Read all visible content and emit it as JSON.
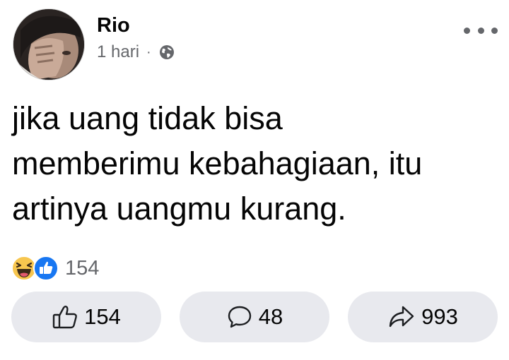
{
  "post": {
    "author": "Rio",
    "time": "1 hari",
    "separator": "·",
    "privacy_icon": "globe-icon",
    "text": "jika uang tidak bisa\nmemberimu kebahagiaan, itu\nartinya uangmu kurang."
  },
  "reactions": {
    "types": [
      "haha-icon",
      "like-icon"
    ],
    "count": "154"
  },
  "actions": {
    "like": {
      "icon": "thumbs-up-icon",
      "count": "154"
    },
    "comment": {
      "icon": "comment-icon",
      "count": "48"
    },
    "share": {
      "icon": "share-icon",
      "count": "993"
    }
  },
  "colors": {
    "meta_text": "#65676b",
    "button_bg": "#e8e9ee",
    "like_blue": "#1877f2",
    "haha_yellow": "#f7c64f"
  }
}
